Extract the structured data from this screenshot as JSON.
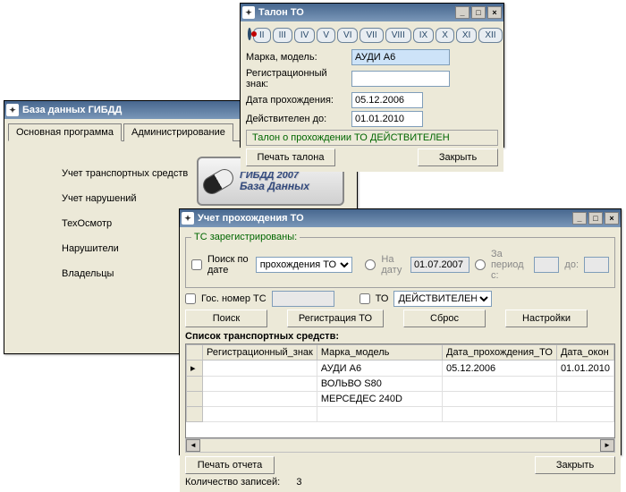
{
  "win1": {
    "title": "База данных ГИБДД",
    "tabs": [
      "Основная программа",
      "Администрирование"
    ],
    "menu": [
      "Учет транспортных средств",
      "Учет нарушений",
      "ТехОсмотр",
      "Нарушители",
      "Владельцы"
    ],
    "logo_line1": "ГИБДД 2007",
    "logo_line2": "База Данных"
  },
  "win2": {
    "title": "Талон ТО",
    "romans": [
      "II",
      "III",
      "IV",
      "V",
      "VI",
      "VII",
      "VIII",
      "IX",
      "X",
      "XI",
      "XII"
    ],
    "rows": [
      {
        "l": "Марка, модель:",
        "v": "АУДИ А6"
      },
      {
        "l": "Регистрационный знак:",
        "v": ""
      },
      {
        "l": "Дата прохождения:",
        "v": "05.12.2006"
      },
      {
        "l": "Действителен до:",
        "v": "01.01.2010"
      }
    ],
    "status": "Талон о прохождении ТО ДЕЙСТВИТЕЛЕН",
    "print": "Печать талона",
    "close": "Закрыть"
  },
  "win3": {
    "title": "Учет прохождения ТО",
    "fieldset_legend": "ТС зарегистрированы:",
    "chk_search": "Поиск по дате",
    "sel_search": "прохождения ТО",
    "radio_date": "На дату",
    "date_val": "01.07.2007",
    "radio_period": "За период с:",
    "period_to": "до:",
    "chk_gos": "Гос. номер ТС",
    "chk_to": "ТО",
    "sel_to": "ДЕЙСТВИТЕЛЕН",
    "btn_search": "Поиск",
    "btn_reg": "Регистрация ТО",
    "btn_reset": "Сброс",
    "btn_settings": "Настройки",
    "list_title": "Список транспортных средств:",
    "cols": [
      "Регистрационный_знак",
      "Марка_модель",
      "Дата_прохождения_ТО",
      "Дата_окон"
    ],
    "rows": [
      {
        "r": "",
        "m": "АУДИ А6",
        "d": "05.12.2006",
        "e": "01.01.2010"
      },
      {
        "r": "",
        "m": "ВОЛЬВО S80",
        "d": "",
        "e": ""
      },
      {
        "r": "",
        "m": "МЕРСЕДЕС 240D",
        "d": "",
        "e": ""
      }
    ],
    "btn_report": "Печать отчета",
    "btn_close": "Закрыть",
    "count_label": "Количество записей:",
    "count_val": "3"
  }
}
